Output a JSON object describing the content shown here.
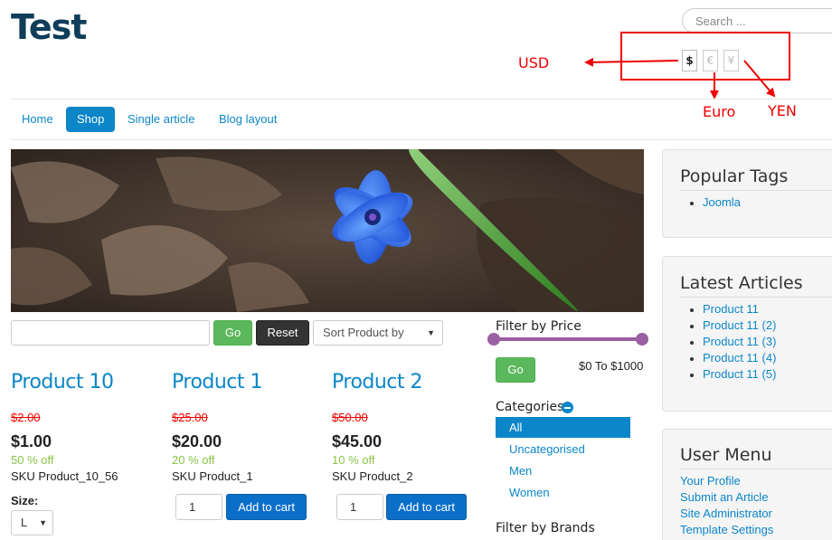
{
  "header": {
    "site_title": "Test",
    "search_placeholder": "Search ..."
  },
  "currency": {
    "buttons": [
      {
        "symbol": "$",
        "active": true
      },
      {
        "symbol": "€",
        "active": false
      },
      {
        "symbol": "¥",
        "active": false
      }
    ],
    "annotations": {
      "usd": "USD",
      "euro": "Euro",
      "yen": "YEN"
    },
    "annotation_color": "#ee0000"
  },
  "nav": {
    "items": [
      {
        "label": "Home",
        "active": false
      },
      {
        "label": "Shop",
        "active": true
      },
      {
        "label": "Single article",
        "active": false
      },
      {
        "label": "Blog layout",
        "active": false
      }
    ]
  },
  "filter_bar": {
    "go_label": "Go",
    "reset_label": "Reset",
    "sort_label": "Sort Product by"
  },
  "products": [
    {
      "name": "Product 10",
      "old_price": "$2.00",
      "price": "$1.00",
      "discount": "50 % off",
      "sku": "SKU Product_10_56"
    },
    {
      "name": "Product 1",
      "old_price": "$25.00",
      "price": "$20.00",
      "discount": "20 % off",
      "sku": "SKU Product_1",
      "qty": "1",
      "cart_label": "Add to cart"
    },
    {
      "name": "Product 2",
      "old_price": "$50.00",
      "price": "$45.00",
      "discount": "10 % off",
      "sku": "SKU Product_2",
      "qty": "1",
      "cart_label": "Add to cart"
    }
  ],
  "size": {
    "label": "Size:",
    "value": "L"
  },
  "filters": {
    "price_heading": "Filter by Price",
    "go_label": "Go",
    "range_text": "$0 To $1000",
    "categories_heading": "Categories",
    "categories": [
      {
        "label": "All",
        "active": true
      },
      {
        "label": "Uncategorised",
        "active": false
      },
      {
        "label": "Men",
        "active": false
      },
      {
        "label": "Women",
        "active": false
      }
    ],
    "brands_heading": "Filter by Brands"
  },
  "sidebar": {
    "popular_tags": {
      "title": "Popular Tags",
      "items": [
        "Joomla"
      ]
    },
    "latest_articles": {
      "title": "Latest Articles",
      "items": [
        "Product 11",
        "Product 11 (2)",
        "Product 11 (3)",
        "Product 11 (4)",
        "Product 11 (5)"
      ]
    },
    "user_menu": {
      "title": "User Menu",
      "items": [
        "Your Profile",
        "Submit an Article",
        "Site Administrator",
        "Template Settings"
      ]
    }
  },
  "colors": {
    "brand_blue": "#0b86c8",
    "title_navy": "#0f3d5a",
    "go_green": "#5cb85c",
    "discount_green": "#8bc34a",
    "slider_purple": "#9b5fa3"
  }
}
